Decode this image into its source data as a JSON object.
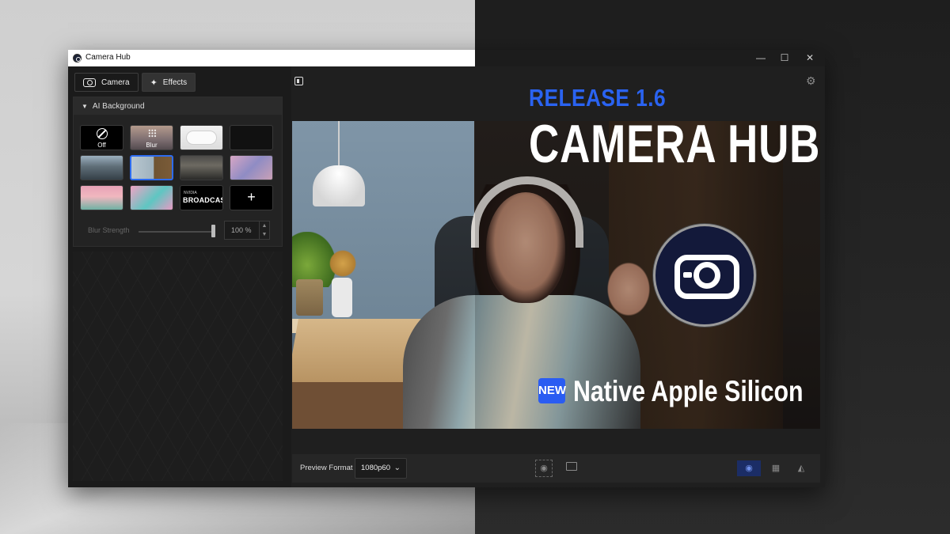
{
  "window": {
    "title": "Camera Hub",
    "controls": {
      "minimize": "—",
      "maximize": "☐",
      "close": "✕"
    }
  },
  "tabs": [
    {
      "label": "Camera"
    },
    {
      "label": "Effects"
    }
  ],
  "ai_background": {
    "section_title": "AI Background",
    "thumbnails": [
      {
        "label": "Off"
      },
      {
        "label": "Blur"
      }
    ],
    "nvidia_small": "NVIDIA",
    "nvidia_big": "BROADCAST",
    "add_symbol": "+",
    "blur_strength_label": "Blur Strength",
    "blur_strength_value": "100 %",
    "blur_strength_level": 1.0
  },
  "bottom_bar": {
    "preview_format_label": "Preview Format",
    "preview_format_value": "1080p60"
  },
  "overlay": {
    "release": "RELEASE 1.6",
    "headline": "CAMERA HUB",
    "new_badge": "NEW",
    "tagline": "Native Apple Silicon"
  },
  "colors": {
    "accent_blue": "#2a63f1",
    "selected_border": "#2d6cf0",
    "badge_blue": "#2a5cf2"
  },
  "icons": [
    "camera-icon",
    "magic-wand-icon",
    "sidebar-toggle-icon",
    "gear-icon",
    "snapshot-icon",
    "folder-icon",
    "eye-icon",
    "grid-icon",
    "mirror-icon",
    "camera-hub-logo"
  ]
}
